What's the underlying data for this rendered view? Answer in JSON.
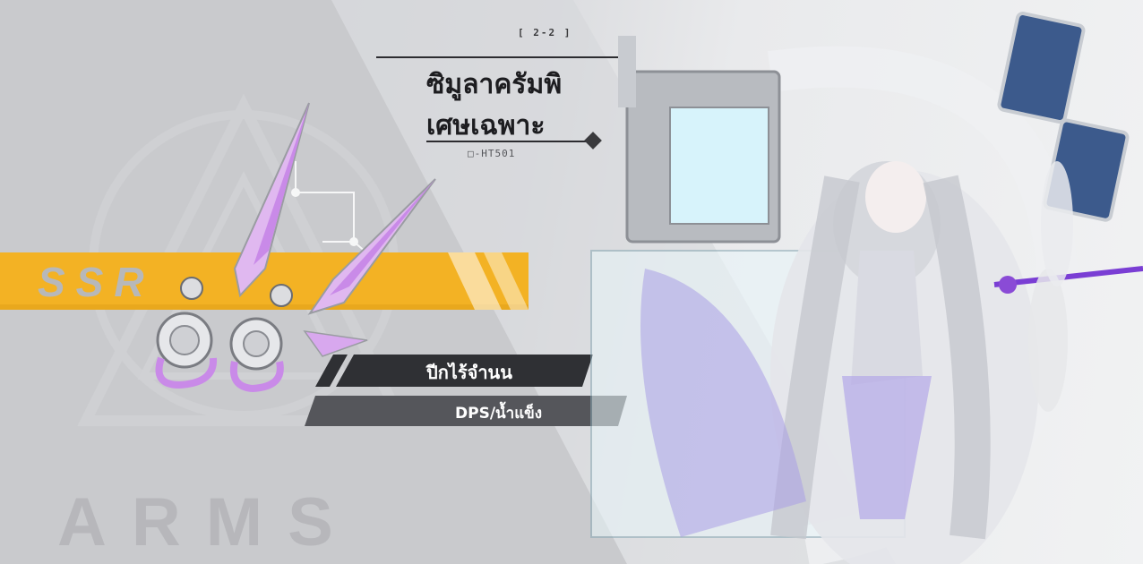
{
  "header": {
    "stage_code": "[ 2-2 ]",
    "title_line1": "ซิมูลาครัมพิ",
    "title_line2": "เศษเฉพาะ",
    "item_code": "□-HT501"
  },
  "weapon": {
    "rarity": "SSR",
    "name": "ปีกไร้จำนน",
    "type": "DPS/น้ำแข็ง",
    "watermark": "ARMS"
  },
  "colors": {
    "rarity_band": "#f3b224",
    "name_plate": "#2f3034",
    "type_plate": "#55565b",
    "accent_purple": "#c98ae8"
  }
}
